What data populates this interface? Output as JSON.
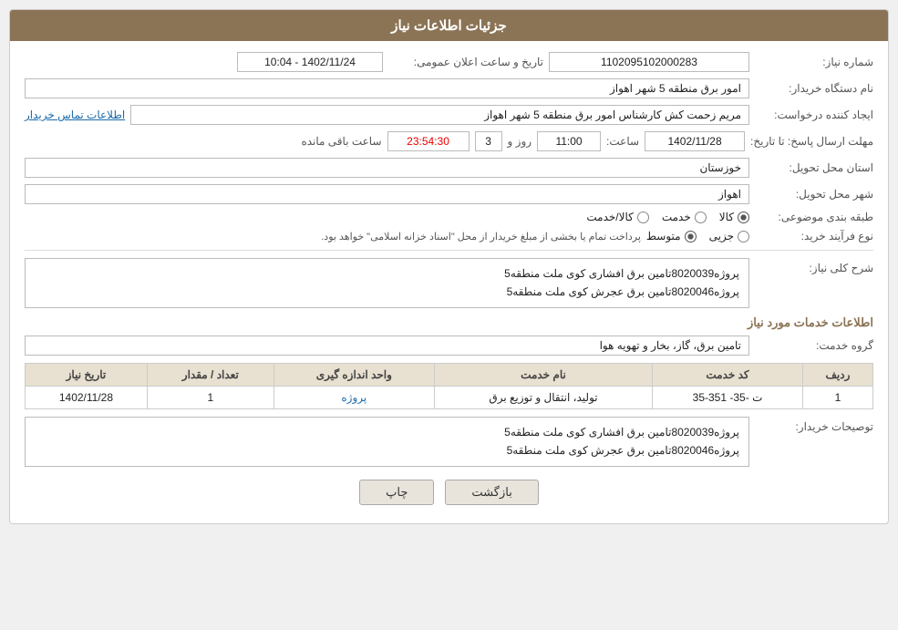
{
  "header": {
    "title": "جزئیات اطلاعات نیاز"
  },
  "fields": {
    "need_number_label": "شماره نیاز:",
    "need_number_value": "1102095102000283",
    "announcement_datetime_label": "تاریخ و ساعت اعلان عمومی:",
    "announcement_datetime_value": "1402/11/24 - 10:04",
    "buyer_org_label": "نام دستگاه خریدار:",
    "buyer_org_value": "امور برق منطقه 5 شهر اهواز",
    "creator_label": "ایجاد کننده درخواست:",
    "creator_value": "مریم زحمت کش کارشناس امور برق منطقه 5 شهر اهواز",
    "contact_link": "اطلاعات تماس خریدار",
    "send_deadline_label": "مهلت ارسال پاسخ: تا تاریخ:",
    "send_date_value": "1402/11/28",
    "send_time_label": "ساعت:",
    "send_time_value": "11:00",
    "send_day_label": "روز و",
    "send_day_value": "3",
    "remaining_label": "ساعت باقی مانده",
    "remaining_value": "23:54:30",
    "province_label": "استان محل تحویل:",
    "province_value": "خوزستان",
    "city_label": "شهر محل تحویل:",
    "city_value": "اهواز",
    "category_label": "طبقه بندی موضوعی:",
    "category_options": [
      "کالا",
      "خدمت",
      "کالا/خدمت"
    ],
    "category_selected": "کالا",
    "purchase_type_label": "نوع فرآیند خرید:",
    "purchase_type_options": [
      "جزیی",
      "متوسط"
    ],
    "purchase_type_selected": "متوسط",
    "purchase_type_note": "پرداخت تمام یا بخشی از مبلغ خریدار از محل \"اسناد خزانه اسلامی\" خواهد بود.",
    "need_description_label": "شرح کلی نیاز:",
    "need_description_line1": "پروژه8020039تامین برق افشاری کوی ملت منطقه5",
    "need_description_line2": "پروژه8020046تامین برق عجرش کوی ملت منطقه5",
    "services_section_title": "اطلاعات خدمات مورد نیاز",
    "service_group_label": "گروه خدمت:",
    "service_group_value": "تامین برق، گاز، بخار و تهویه هوا",
    "table_headers": [
      "ردیف",
      "کد خدمت",
      "نام خدمت",
      "واحد اندازه گیری",
      "تعداد / مقدار",
      "تاریخ نیاز"
    ],
    "table_rows": [
      {
        "row": "1",
        "service_code": "ت -35- 351-35",
        "service_name": "تولید، انتقال و توزیع برق",
        "unit": "پروژه",
        "quantity": "1",
        "date": "1402/11/28"
      }
    ],
    "buyer_notes_label": "توصیحات خریدار:",
    "buyer_notes_line1": "پروژه8020039تامین برق افشاری کوی ملت منطقه5",
    "buyer_notes_line2": "پروژه8020046تامین برق عجرش کوی ملت منطقه5"
  },
  "buttons": {
    "print_label": "چاپ",
    "back_label": "بازگشت"
  }
}
